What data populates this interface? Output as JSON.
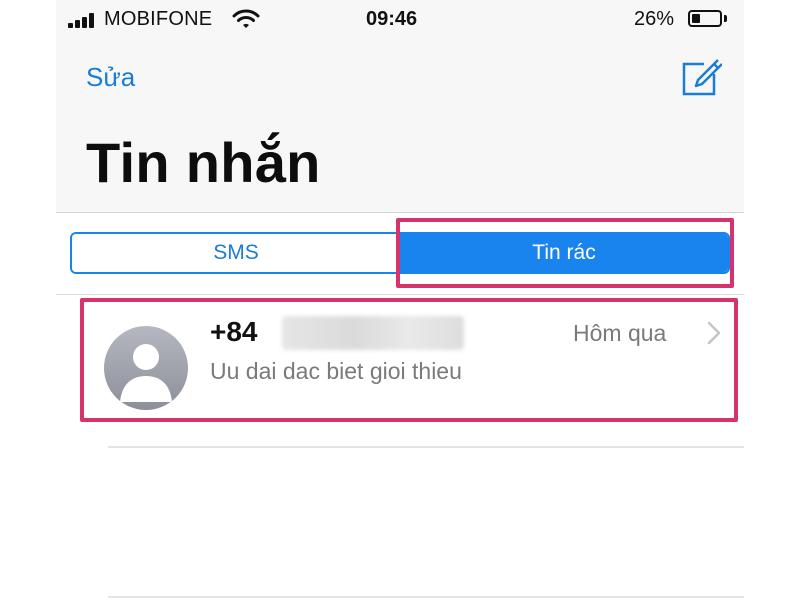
{
  "status_bar": {
    "carrier": "MOBIFONE",
    "time": "09:46",
    "battery_percent": "26%",
    "battery_level": 0.26
  },
  "nav": {
    "edit_label": "Sửa",
    "compose_icon": "compose-icon"
  },
  "title": "Tin nhắn",
  "tabs": [
    {
      "label": "SMS",
      "selected": false
    },
    {
      "label": "Tin rác",
      "selected": true
    }
  ],
  "messages": [
    {
      "sender_prefix": "+84",
      "time": "Hôm qua",
      "preview": "Uu dai dac biet gioi thieu",
      "avatar_icon": "person-icon"
    }
  ],
  "colors": {
    "accent": "#1a84ee",
    "link": "#1a7cd6",
    "highlight": "#d6336c"
  }
}
